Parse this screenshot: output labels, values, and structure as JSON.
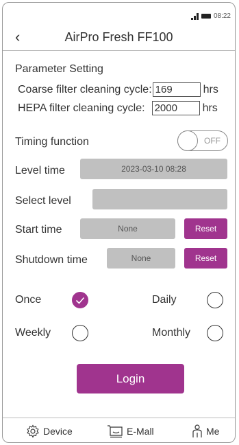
{
  "status": {
    "time": "08:22"
  },
  "header": {
    "title": "AirPro Fresh FF100"
  },
  "params": {
    "section_title": "Parameter Setting",
    "coarse_label": "Coarse filter cleaning cycle:",
    "coarse_value": "169",
    "hepa_label": "HEPA filter cleaning cycle:",
    "hepa_value": "2000",
    "unit": "hrs"
  },
  "timing": {
    "label": "Timing function",
    "toggle_state": "OFF",
    "level_time_label": "Level time",
    "level_time_value": "2023-03-10 08:28",
    "select_level_label": "Select level",
    "start_time_label": "Start time",
    "start_time_value": "None",
    "shutdown_time_label": "Shutdown time",
    "shutdown_time_value": "None",
    "reset_label": "Reset"
  },
  "repeat": {
    "once": "Once",
    "daily": "Daily",
    "weekly": "Weekly",
    "monthly": "Monthly",
    "selected": "Once"
  },
  "login_label": "Login",
  "tabs": [
    {
      "label": "Device",
      "icon": "gear-icon"
    },
    {
      "label": "E-Mall",
      "icon": "cart-icon"
    },
    {
      "label": "Me",
      "icon": "person-icon"
    }
  ],
  "colors": {
    "accent": "#a0348e",
    "field": "#c0c0c0"
  }
}
